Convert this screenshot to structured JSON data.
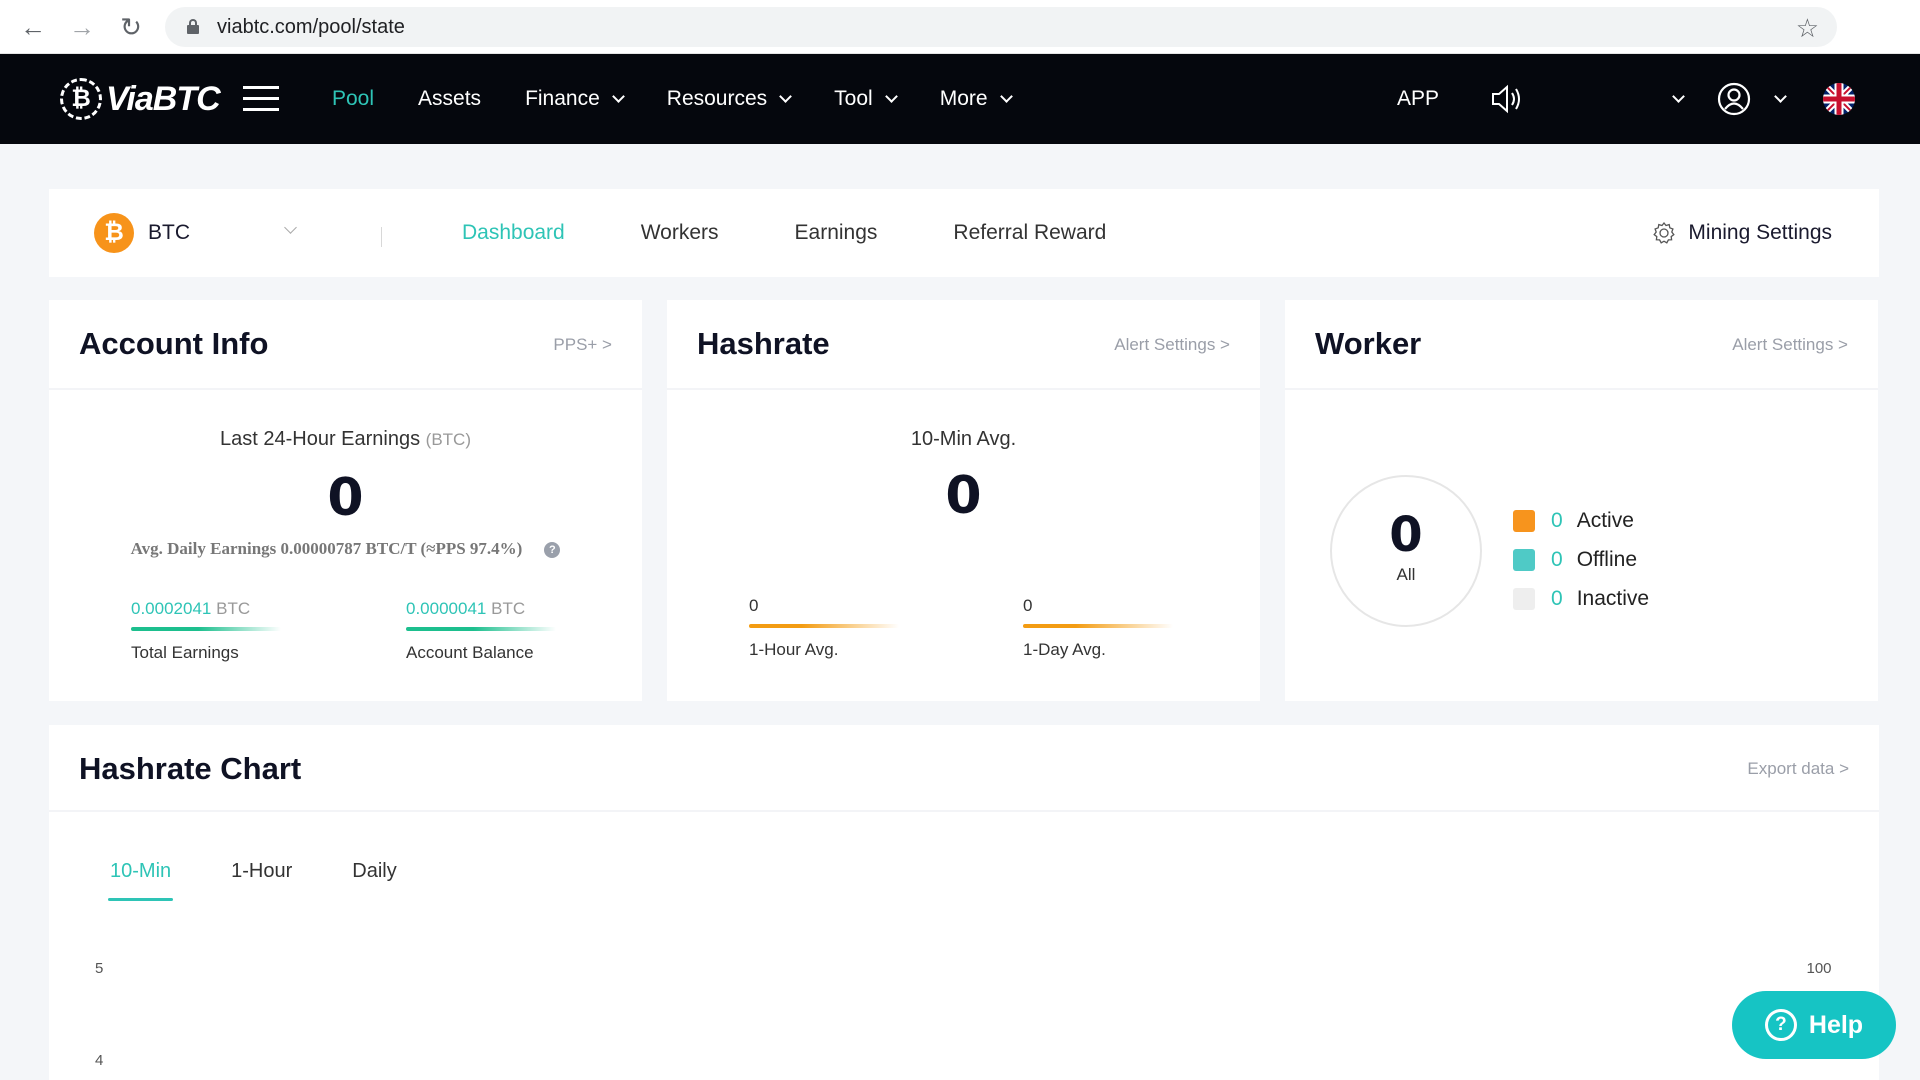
{
  "browser": {
    "url": "viabtc.com/pool/state",
    "back_icon": "←",
    "forward_icon": "→",
    "reload_icon": "↻",
    "star_icon": "☆"
  },
  "nav": {
    "brand": "ViaBTC",
    "brand_mark": "₿",
    "items": [
      {
        "label": "Pool",
        "active": true,
        "dropdown": false
      },
      {
        "label": "Assets",
        "active": false,
        "dropdown": false
      },
      {
        "label": "Finance",
        "active": false,
        "dropdown": true
      },
      {
        "label": "Resources",
        "active": false,
        "dropdown": true
      },
      {
        "label": "Tool",
        "active": false,
        "dropdown": true
      },
      {
        "label": "More",
        "active": false,
        "dropdown": true
      }
    ],
    "app_label": "APP"
  },
  "coinbar": {
    "coin": "BTC",
    "coin_symbol": "₿",
    "tabs": [
      {
        "label": "Dashboard",
        "active": true
      },
      {
        "label": "Workers",
        "active": false
      },
      {
        "label": "Earnings",
        "active": false
      },
      {
        "label": "Referral Reward",
        "active": false
      }
    ],
    "mining_settings": "Mining Settings"
  },
  "account": {
    "title": "Account Info",
    "link": "PPS+ >",
    "earnings_label": "Last 24-Hour Earnings",
    "earnings_unit": "(BTC)",
    "earnings_value": "0",
    "avg_daily": "Avg. Daily Earnings 0.00000787 BTC/T (≈PPS 97.4%)",
    "help_glyph": "?",
    "total_earnings_value": "0.0002041",
    "total_earnings_unit": "BTC",
    "total_earnings_label": "Total Earnings",
    "balance_value": "0.0000041",
    "balance_unit": "BTC",
    "balance_label": "Account Balance"
  },
  "hashrate": {
    "title": "Hashrate",
    "link": "Alert Settings >",
    "ten_min_label": "10-Min Avg.",
    "ten_min_value": "0",
    "hour_value": "0",
    "hour_label": "1-Hour Avg.",
    "day_value": "0",
    "day_label": "1-Day Avg."
  },
  "worker": {
    "title": "Worker",
    "link": "Alert Settings >",
    "all_value": "0",
    "all_label": "All",
    "legend": [
      {
        "label": "Active",
        "count": "0",
        "color": "#f7941d"
      },
      {
        "label": "Offline",
        "count": "0",
        "color": "#4fcac6"
      },
      {
        "label": "Inactive",
        "count": "0",
        "color": "#eeeeee"
      }
    ]
  },
  "chart_section": {
    "title": "Hashrate Chart",
    "export": "Export data >",
    "tabs": [
      {
        "label": "10-Min",
        "active": true
      },
      {
        "label": "1-Hour",
        "active": false
      },
      {
        "label": "Daily",
        "active": false
      }
    ]
  },
  "chart_data": {
    "type": "line",
    "title": "Hashrate Chart",
    "left_axis_ticks_visible": [
      "5",
      "4"
    ],
    "right_axis_ticks_visible": [
      "100"
    ],
    "series": [],
    "grid": false
  },
  "help_button": {
    "label": "Help",
    "glyph": "?"
  },
  "colors": {
    "accent": "#2ec4b6",
    "nav_bg": "#05070d",
    "btc_orange": "#f7931a",
    "help_btn": "#16c4c4"
  }
}
